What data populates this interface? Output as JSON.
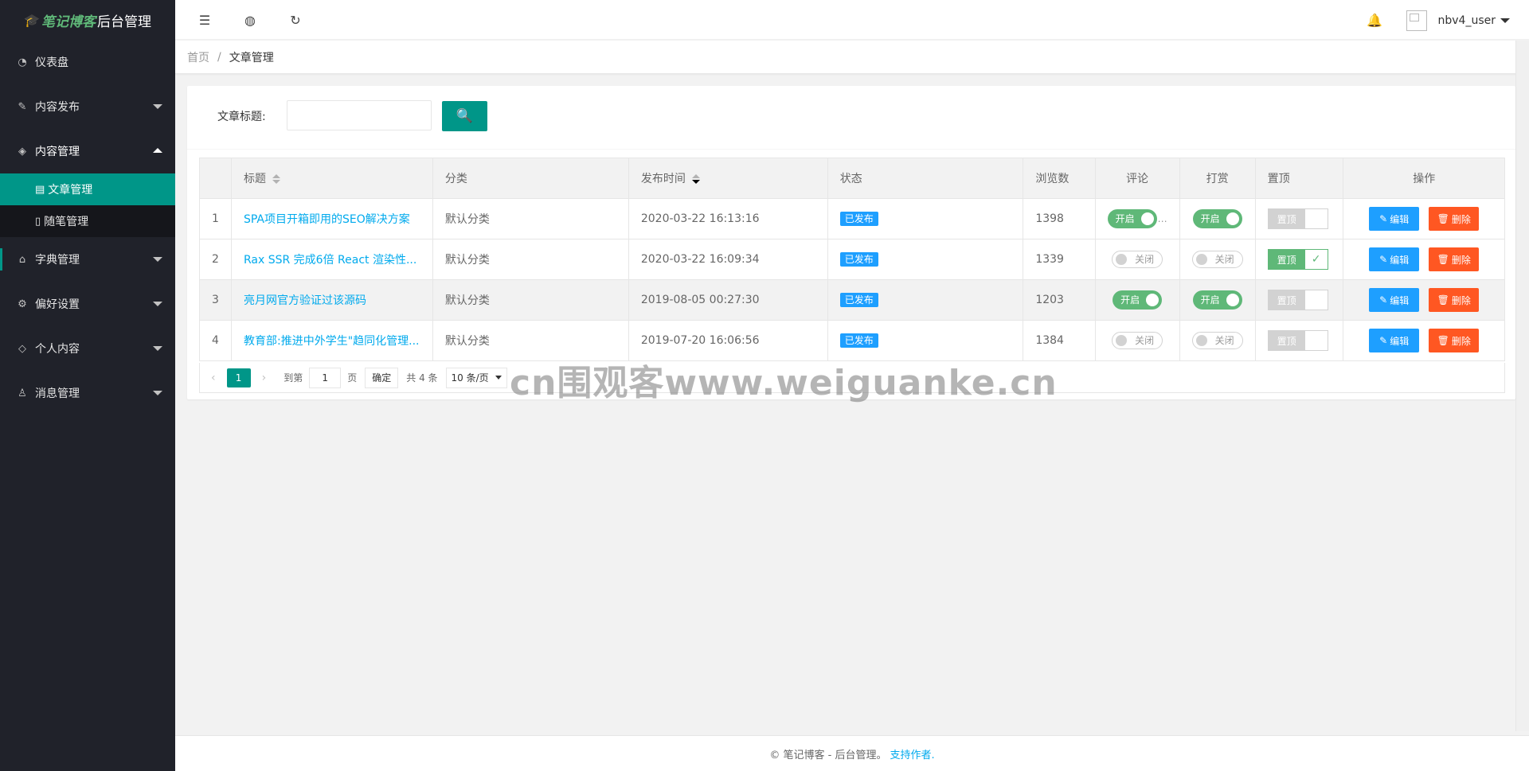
{
  "logo": {
    "brand": "笔记博客",
    "suffix": "后台管理"
  },
  "sidebar": {
    "items": [
      {
        "label": "仪表盘"
      },
      {
        "label": "内容发布"
      },
      {
        "label": "内容管理"
      },
      {
        "label": "字典管理"
      },
      {
        "label": "偏好设置"
      },
      {
        "label": "个人内容"
      },
      {
        "label": "消息管理"
      }
    ],
    "sub": [
      {
        "label": "文章管理"
      },
      {
        "label": "随笔管理"
      }
    ]
  },
  "header": {
    "username": "nbv4_user"
  },
  "breadcrumb": {
    "home": "首页",
    "separator": "/",
    "current": "文章管理"
  },
  "search": {
    "label": "文章标题:",
    "placeholder": ""
  },
  "table": {
    "headers": [
      "标题",
      "分类",
      "发布时间",
      "状态",
      "浏览数",
      "评论",
      "打赏",
      "置顶",
      "操作"
    ],
    "rows": [
      {
        "num": "1",
        "title": "SPA项目开箱即用的SEO解决方案",
        "category": "默认分类",
        "time": "2020-03-22 16:13:16",
        "status": "已发布",
        "views": "1398",
        "comment": "开启",
        "reward": "开启",
        "top": "置顶"
      },
      {
        "num": "2",
        "title": "Rax SSR 完成6倍 React 渲染性...",
        "category": "默认分类",
        "time": "2020-03-22 16:09:34",
        "status": "已发布",
        "views": "1339",
        "comment": "关闭",
        "reward": "关闭",
        "top": "置顶"
      },
      {
        "num": "3",
        "title": "亮月网官方验证过该源码",
        "category": "默认分类",
        "time": "2019-08-05 00:27:30",
        "status": "已发布",
        "views": "1203",
        "comment": "开启",
        "reward": "开启",
        "top": "置顶"
      },
      {
        "num": "4",
        "title": "教育部:推进中外学生\"趋同化管理...",
        "category": "默认分类",
        "time": "2019-07-20 16:06:56",
        "status": "已发布",
        "views": "1384",
        "comment": "关闭",
        "reward": "关闭",
        "top": "置顶"
      }
    ],
    "edit_label": "编辑",
    "delete_label": "删除"
  },
  "pager": {
    "current": "1",
    "goto_label": "到第",
    "goto_value": "1",
    "page_unit": "页",
    "confirm": "确定",
    "total": "共 4 条",
    "per_page": "10 条/页"
  },
  "footer": {
    "text": "© 笔记博客 - 后台管理。",
    "link": "支持作者."
  },
  "watermark": "cn围观客www.weiguanke.cn",
  "colors": {
    "accent": "#009688",
    "sidebar": "#20222a",
    "link": "#01aaed",
    "on": "#5fb878",
    "edit": "#1e9fff",
    "delete": "#ff5722"
  }
}
